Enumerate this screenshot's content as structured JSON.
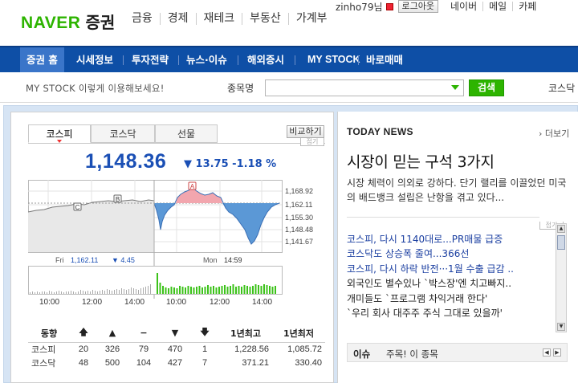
{
  "header": {
    "logo_naver": "NAVER",
    "logo_stock": "증권",
    "nav": [
      "금융",
      "경제",
      "재테크",
      "부동산",
      "가계부"
    ],
    "user": "zinho79님",
    "logout": "로그아웃",
    "links": [
      "네이버",
      "메일",
      "카페"
    ]
  },
  "gnb": {
    "items": [
      "증권 홈",
      "시세정보",
      "투자전략",
      "뉴스·이슈",
      "해외증시",
      "MY STOCK",
      "바로매매"
    ]
  },
  "search": {
    "hint": "MY STOCK 이렇게 이용해보세요!",
    "label": "종목명",
    "placeholder": "",
    "button": "검색",
    "right_label": "코스닥"
  },
  "tabs": [
    "코스피",
    "코스닥",
    "선물"
  ],
  "compare_label": "비교하기",
  "fold_label": "접기",
  "index": {
    "value": "1,148.36",
    "change": "▼ 13.75  -1.18 %"
  },
  "chart_data": {
    "type": "line",
    "yticks": [
      "1,168.92",
      "1,162.11",
      "1,155.30",
      "1,148.48",
      "1,141.67"
    ],
    "xticks": [
      "10:00",
      "12:00",
      "14:00",
      "10:00",
      "12:00",
      "14:00"
    ],
    "prev_day": {
      "label": "Fri",
      "value": "1,162.11",
      "change": "▼ 4.45"
    },
    "cur_day": {
      "label": "Mon",
      "time": "14:59"
    },
    "markers": [
      "C",
      "B",
      "A"
    ]
  },
  "stats": {
    "headers": [
      "동향",
      "▲",
      "▲",
      "−",
      "▼",
      "▼",
      "1년최고",
      "1년최저"
    ],
    "rows": [
      [
        "코스피",
        "20",
        "326",
        "79",
        "470",
        "1",
        "1,228.56",
        "1,085.72"
      ],
      [
        "코스닥",
        "48",
        "500",
        "104",
        "427",
        "7",
        "371.21",
        "330.40"
      ]
    ]
  },
  "news": {
    "title": "TODAY NEWS",
    "more": "더보기",
    "headline": "시장이 믿는 구석 3가지",
    "summary": "시장 체력이 의외로 강하다. 단기 랠리를 이끌었던 미국의 배드뱅크 설립은 난항을 겪고 있다...",
    "items": [
      {
        "text": "코스피, 다시 1140대로...PR매물 급증",
        "color": "blue"
      },
      {
        "text": "코스닥도 상승폭 줄여...366선",
        "color": "blue"
      },
      {
        "text": "코스피, 다시 하락 반전···1월 수출 급감 ..",
        "color": "blue"
      },
      {
        "text": "외국인도 별수있나 `박스장'엔 치고빠지..",
        "color": "black"
      },
      {
        "text": "개미들도 `프로그램 차익거래 한다'",
        "color": "black"
      },
      {
        "text": "`우리 회사 대주주 주식 그대로 있을까'",
        "color": "black"
      }
    ],
    "issue_label": "이슈",
    "issue_text": "주목! 이 종목"
  }
}
